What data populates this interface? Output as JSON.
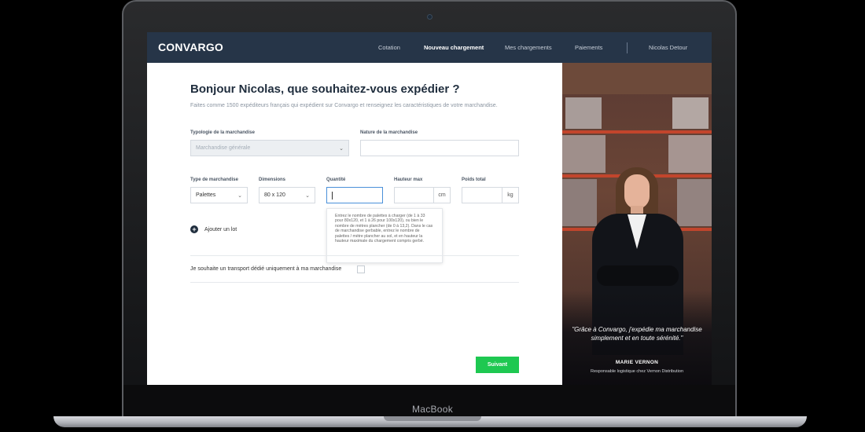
{
  "device": {
    "brand": "MacBook"
  },
  "nav": {
    "logo": "CONVARGO",
    "links": [
      "Cotation",
      "Nouveau chargement",
      "Mes chargements",
      "Paiements"
    ],
    "active_index": 1,
    "user": "Nicolas Detour"
  },
  "form": {
    "heading": "Bonjour Nicolas, que souhaitez-vous expédier ?",
    "subheading": "Faites comme 1500 expéditeurs français qui expédient sur Convargo et renseignez les caractéristiques de votre marchandise.",
    "typologie_label": "Typologie de la marchandise",
    "typologie_value": "Marchandise générale",
    "nature_label": "Nature de la marchandise",
    "nature_value": "",
    "type_label": "Type de marchandise",
    "type_value": "Palettes",
    "dimensions_label": "Dimensions",
    "dimensions_value": "80 x 120",
    "quantite_label": "Quantité",
    "hauteur_label": "Hauteur max",
    "hauteur_unit": "cm",
    "poids_label": "Poids total",
    "poids_unit": "kg",
    "tooltip": "Entrez le nombre de palettes à charger (de 1 à 33 pour 80x120, et 1 à 26 pour 100x120), ou bien le nombre de mètres plancher (de 0 à 13,2). Dans le cas de marchandise gerbable, entrez le nombre de palettes / mètre plancher au sol, et en hauteur la hauteur maximale du chargement compris gerbé.",
    "add_lot": "Ajouter un lot",
    "transport_label": "Je souhaite un transport dédié uniquement à ma marchandise",
    "next_button": "Suivant"
  },
  "testimonial": {
    "quote": "\"Grâce à Convargo, j'expédie ma marchandise simplement et en toute sérénité.\"",
    "name": "MARIE VERNON",
    "role": "Responsable logistique chez Vernon Distribution"
  },
  "colors": {
    "nav_bg": "#263548",
    "accent_green": "#1ec851",
    "heading": "#1f2d3d"
  }
}
